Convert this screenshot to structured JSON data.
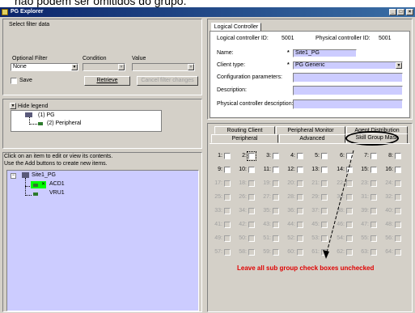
{
  "banner_text": "não podem ser omitidos do grupo.",
  "window": {
    "title": "PG Explorer"
  },
  "filter_panel": {
    "title": "Select filter data",
    "optional_filter_label": "Optional Filter",
    "condition_label": "Condition",
    "value_label": "Value",
    "optional_filter_value": "None",
    "condition_value": "",
    "value_value": "",
    "save_label": "Save",
    "retrieve_label": "Retrieve",
    "cancel_label": "Cancel filter changes"
  },
  "legend": {
    "toggle_label": "Hide legend",
    "items": [
      "(1) PG",
      "(2) Peripheral"
    ]
  },
  "tree_panel": {
    "instruction1": "Click on an item to edit or view its contents.",
    "instruction2": "Use the Add buttons to create new items.",
    "nodes": [
      "Site1_PG",
      "ACD1",
      "VRU1"
    ]
  },
  "logical_controller": {
    "tab": "Logical Controller",
    "id_label": "Logical controller ID:",
    "id_value": "5001",
    "phys_id_label": "Physical controller ID:",
    "phys_id_value": "5001",
    "name_label": "Name:",
    "name_value": "Site1_PG",
    "client_type_label": "Client type:",
    "client_type_value": "PG Generic",
    "config_label": "Configuration parameters:",
    "desc_label": "Description:",
    "phys_desc_label": "Physical controller description:",
    "required_mark": "*"
  },
  "tabs_row1": [
    "Routing Client",
    "Peripheral Monitor",
    "Agent Distribution"
  ],
  "tabs_row2": [
    "Peripheral",
    "Advanced",
    "Skill Group Mask"
  ],
  "skill_grid": {
    "rows": [
      [
        1,
        2,
        3,
        4,
        5,
        6,
        7,
        8
      ],
      [
        9,
        10,
        11,
        12,
        13,
        14,
        15,
        16
      ],
      [
        17,
        18,
        19,
        20,
        21,
        22,
        23,
        24
      ],
      [
        25,
        26,
        27,
        28,
        29,
        30,
        31,
        32
      ],
      [
        33,
        34,
        35,
        36,
        37,
        38,
        39,
        40
      ],
      [
        41,
        42,
        43,
        44,
        45,
        46,
        47,
        48
      ],
      [
        49,
        50,
        51,
        52,
        53,
        54,
        55,
        56
      ],
      [
        57,
        58,
        59,
        60,
        61,
        62,
        63,
        64
      ]
    ],
    "enabled_rows": 2
  },
  "annotation": "Leave all sub group check boxes unchecked",
  "colors": {
    "title_start": "#0a246a",
    "title_end": "#3a6ea5",
    "tree_bg": "#ccccff",
    "annotation": "#e00000",
    "acd_highlight": "#00ff00"
  }
}
